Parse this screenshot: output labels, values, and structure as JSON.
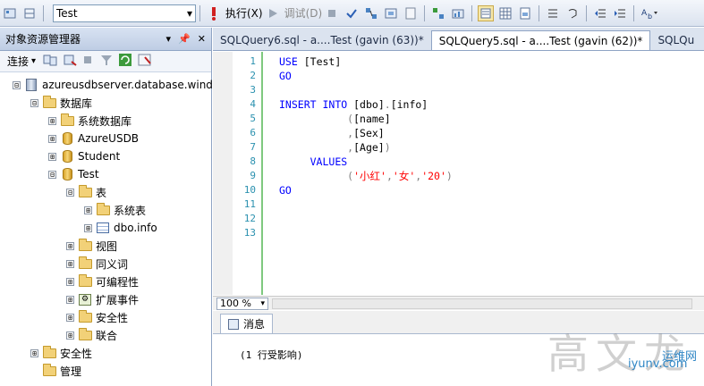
{
  "toolbar": {
    "database": "Test",
    "execute_label": "执行(X)",
    "debug_label": "调试(D)"
  },
  "object_explorer": {
    "title": "对象资源管理器",
    "connect_label": "连接",
    "tree": [
      {
        "label": "azureusdbserver.database.wind",
        "icon": "server-icon",
        "expander": "⊟",
        "indent": 0
      },
      {
        "label": "数据库",
        "icon": "folder-icon",
        "expander": "⊟",
        "indent": 1
      },
      {
        "label": "系统数据库",
        "icon": "folder-icon",
        "expander": "⊞",
        "indent": 2
      },
      {
        "label": "AzureUSDB",
        "icon": "database-icon",
        "expander": "⊞",
        "indent": 2
      },
      {
        "label": "Student",
        "icon": "database-icon",
        "expander": "⊞",
        "indent": 2
      },
      {
        "label": "Test",
        "icon": "database-icon",
        "expander": "⊟",
        "indent": 2
      },
      {
        "label": "表",
        "icon": "folder-icon",
        "expander": "⊟",
        "indent": 3
      },
      {
        "label": "系统表",
        "icon": "folder-icon",
        "expander": "⊞",
        "indent": 4
      },
      {
        "label": "dbo.info",
        "icon": "table-icon",
        "expander": "⊞",
        "indent": 4
      },
      {
        "label": "视图",
        "icon": "folder-icon",
        "expander": "⊞",
        "indent": 3
      },
      {
        "label": "同义词",
        "icon": "folder-icon",
        "expander": "⊞",
        "indent": 3
      },
      {
        "label": "可编程性",
        "icon": "folder-icon",
        "expander": "⊞",
        "indent": 3
      },
      {
        "label": "扩展事件",
        "icon": "extended-events-icon",
        "expander": "⊞",
        "indent": 3
      },
      {
        "label": "安全性",
        "icon": "folder-icon",
        "expander": "⊞",
        "indent": 3
      },
      {
        "label": "联合",
        "icon": "folder-icon",
        "expander": "⊞",
        "indent": 3
      },
      {
        "label": "安全性",
        "icon": "folder-icon",
        "expander": "⊞",
        "indent": 1
      },
      {
        "label": "管理",
        "icon": "folder-icon",
        "expander": "",
        "indent": 1
      }
    ]
  },
  "tabs": [
    {
      "label": "SQLQuery6.sql - a....Test (gavin (63))*",
      "active": false
    },
    {
      "label": "SQLQuery5.sql - a....Test (gavin (62))*",
      "active": true
    },
    {
      "label": "SQLQu",
      "active": false
    }
  ],
  "editor": {
    "lines": [
      {
        "n": "1",
        "text": "USE [Test]"
      },
      {
        "n": "2",
        "text": "GO"
      },
      {
        "n": "3",
        "text": ""
      },
      {
        "n": "4",
        "text": "INSERT INTO [dbo].[info]"
      },
      {
        "n": "5",
        "text": "           ([name]"
      },
      {
        "n": "6",
        "text": "           ,[Sex]"
      },
      {
        "n": "7",
        "text": "           ,[Age])"
      },
      {
        "n": "8",
        "text": "     VALUES"
      },
      {
        "n": "9",
        "text": "           ('小红','女','20')"
      },
      {
        "n": "10",
        "text": "GO"
      },
      {
        "n": "11",
        "text": ""
      },
      {
        "n": "12",
        "text": ""
      },
      {
        "n": "13",
        "text": ""
      }
    ],
    "zoom": "100 %"
  },
  "results": {
    "tab_label": "消息",
    "message": "(1 行受影响)"
  },
  "watermark": {
    "text": "高文龙",
    "site_cn": "运维网",
    "site": "iyunv.com"
  },
  "colors": {
    "keyword": "#0000ff",
    "string": "#ff0000",
    "identifier": "#000000",
    "operator": "#808080",
    "linenum": "#2b91af"
  }
}
